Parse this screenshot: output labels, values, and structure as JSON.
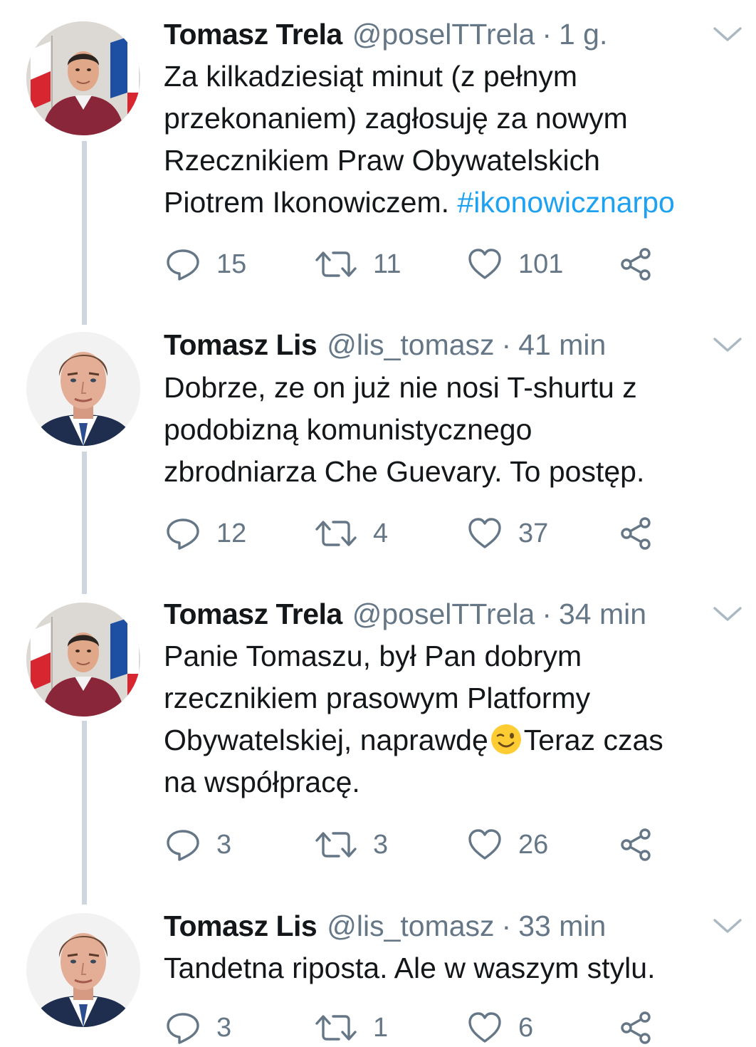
{
  "tweets": [
    {
      "name": "Tomasz Trela",
      "handle": "@poselTTrela",
      "separator": "·",
      "time": "1 g.",
      "text": "Za kilkadziesiąt minut (z pełnym\nprzekonaniem) zagłosuję za nowym\nRzecznikiem Praw Obywatelskich\nPiotrem Ikonowiczem. ",
      "hashtag": "#ikonowicznarpo",
      "replies": "15",
      "retweets": "11",
      "likes": "101",
      "avatar": "person-red-sweater-flags"
    },
    {
      "name": "Tomasz Lis",
      "handle": "@lis_tomasz",
      "separator": "·",
      "time": "41 min",
      "text": "Dobrze, ze on już nie nosi T-shurtu z\npodobizną komunistycznego\nzbrodniarza Che Guevary. To postęp.",
      "replies": "12",
      "retweets": "4",
      "likes": "37",
      "avatar": "person-suit-portrait"
    },
    {
      "name": "Tomasz Trela",
      "handle": "@poselTTrela",
      "separator": "·",
      "time": "34 min",
      "text_before_emoji": "Panie Tomaszu, był Pan dobrym\nrzecznikiem prasowym Platformy\nObywatelskiej, naprawdę",
      "emoji": "winking-face",
      "text_after_emoji": "Teraz czas\nna współpracę.",
      "replies": "3",
      "retweets": "3",
      "likes": "26",
      "avatar": "person-red-sweater-flags"
    },
    {
      "name": "Tomasz Lis",
      "handle": "@lis_tomasz",
      "separator": "·",
      "time": "33 min",
      "text": "Tandetna riposta. Ale w waszym stylu.",
      "replies": "3",
      "retweets": "1",
      "likes": "6",
      "avatar": "person-suit-portrait"
    }
  ],
  "icons": [
    "reply-icon",
    "retweet-icon",
    "like-icon",
    "share-icon",
    "chevron-down-icon"
  ],
  "colors": {
    "text": "#14171a",
    "secondary": "#657786",
    "link": "#1da1f2",
    "thread_line": "#cdd6de"
  }
}
